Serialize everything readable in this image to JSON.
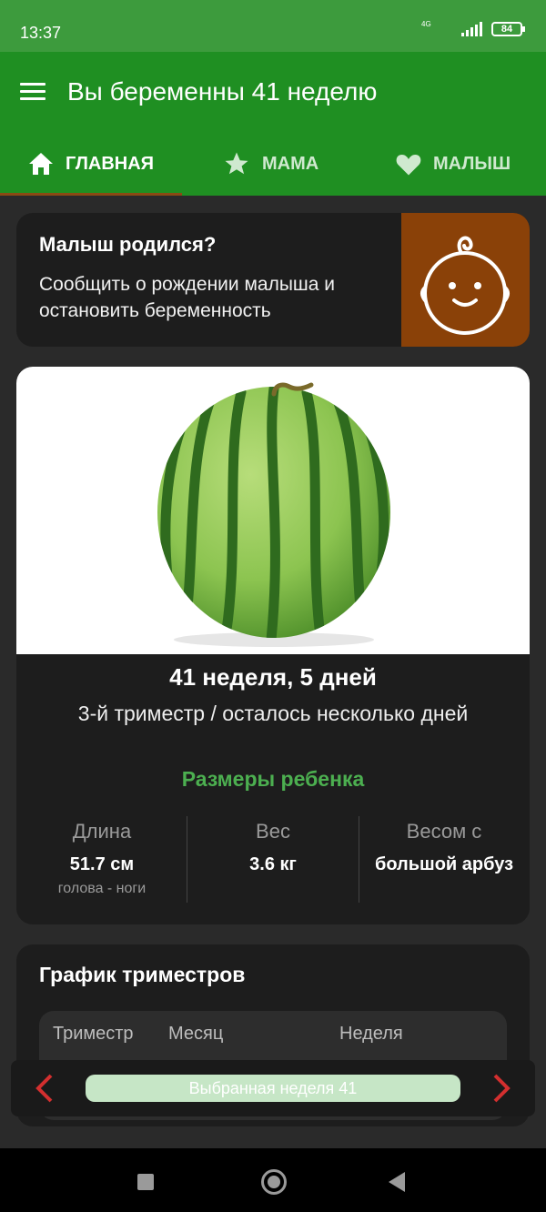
{
  "status": {
    "time": "13:37",
    "network": "4G",
    "battery": "84"
  },
  "app_bar": {
    "title": "Вы беременны 41 неделю"
  },
  "tabs": [
    {
      "label": "ГЛАВНАЯ",
      "icon": "home-icon",
      "active": true
    },
    {
      "label": "МАМА",
      "icon": "star-icon",
      "active": false
    },
    {
      "label": "МАЛЫШ",
      "icon": "heart-icon",
      "active": false
    }
  ],
  "born_card": {
    "title": "Малыш родился?",
    "text": "Сообщить о рождении малыша и остановить беременность",
    "icon": "baby-face-icon"
  },
  "week_card": {
    "image": "watermelon",
    "week_title": "41 неделя, 5 дней",
    "trimester_text": "3-й триместр / осталось несколько дней",
    "sizes_title": "Размеры ребенка",
    "metrics": [
      {
        "label": "Длина",
        "value": "51.7 см",
        "sub": "голова - ноги"
      },
      {
        "label": "Вес",
        "value": "3.6 кг"
      },
      {
        "label": "Весом с",
        "value": "большой арбуз"
      }
    ]
  },
  "chart_card": {
    "title": "График триместров",
    "columns": [
      "Триместр",
      "Месяц",
      "Неделя"
    ]
  },
  "week_nav": {
    "label": "Выбранная неделя 41"
  },
  "colors": {
    "primary": "#1f8f22",
    "accent": "#8a4108",
    "highlight": "#4caf50",
    "arrow": "#d32f2f"
  }
}
